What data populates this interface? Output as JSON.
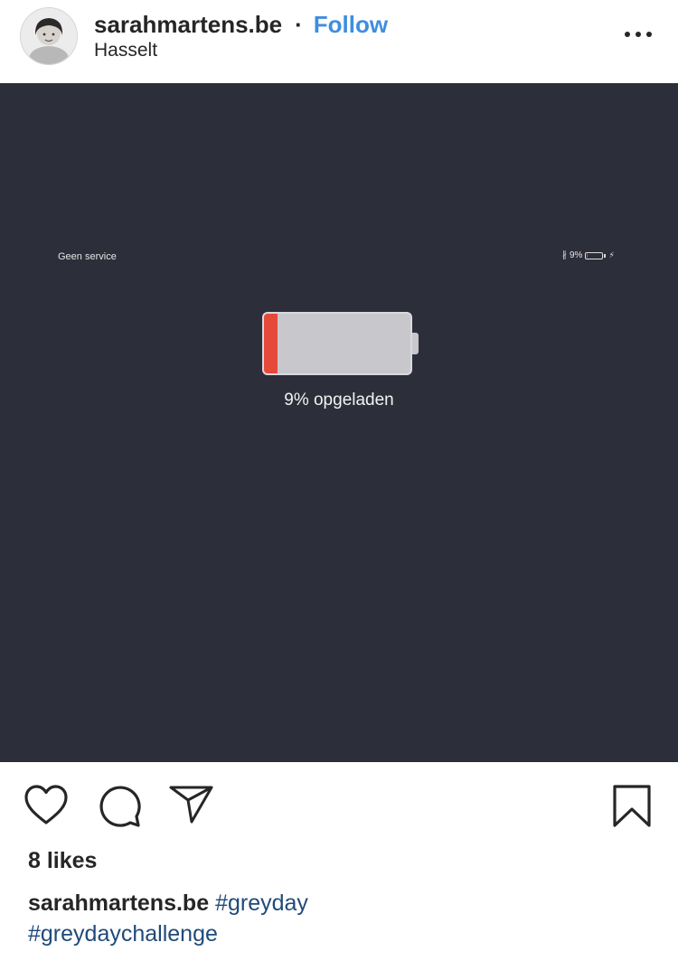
{
  "post": {
    "username": "sarahmartens.be",
    "separator": "·",
    "follow_label": "Follow",
    "location": "Hasselt",
    "avatar_icon": "profile-photo",
    "more_icon": "more-horizontal-icon"
  },
  "image": {
    "status_left": "Geen service",
    "status_bluetooth": "∦",
    "status_battery_percent": "9%",
    "status_charging": "⚡",
    "charge_text": "9% opgeladen",
    "battery_level": 0.09,
    "battery_color": "#e5493b",
    "background_color": "#2c2f3a"
  },
  "actions": {
    "like_icon": "heart-icon",
    "comment_icon": "comment-icon",
    "share_icon": "paper-plane-icon",
    "save_icon": "bookmark-icon"
  },
  "likes_text": "8 likes",
  "caption": {
    "username": "sarahmartens.be",
    "hashtags": [
      "#greyday",
      "#greydaychallenge"
    ]
  },
  "colors": {
    "follow": "#3f8ee0",
    "hashtag": "#1f4a7a"
  }
}
